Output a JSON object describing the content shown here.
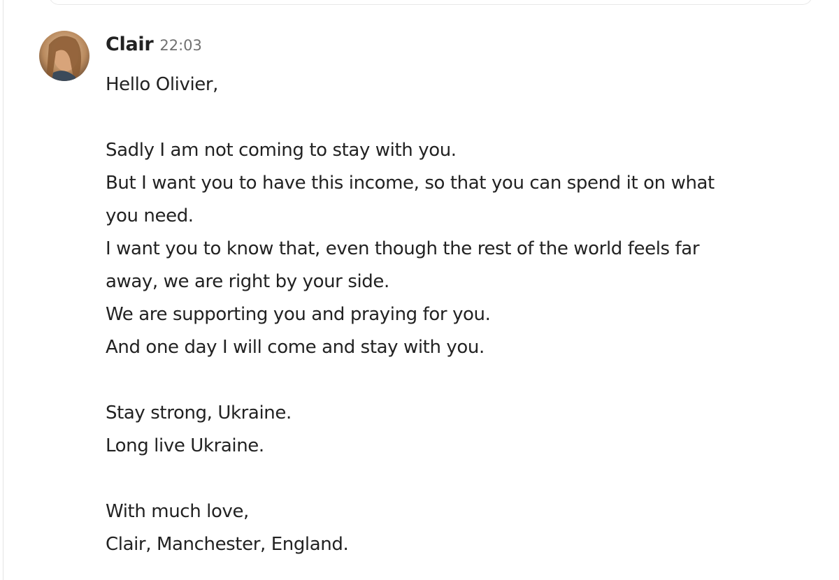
{
  "message": {
    "sender": "Clair",
    "time": "22:03",
    "lines": [
      "Hello Olivier,",
      "",
      "Sadly I am not coming to stay with you.",
      "But I want you to have this income, so that you can spend it on what",
      "you need.",
      "I want you to know that, even though the rest of the world feels far",
      "away, we are right by your side.",
      "We are supporting you and praying for you.",
      "And one day I will come and stay with you.",
      "",
      "Stay strong, Ukraine.",
      "Long live Ukraine.",
      "",
      "With much love,",
      "Clair, Manchester, England."
    ]
  }
}
